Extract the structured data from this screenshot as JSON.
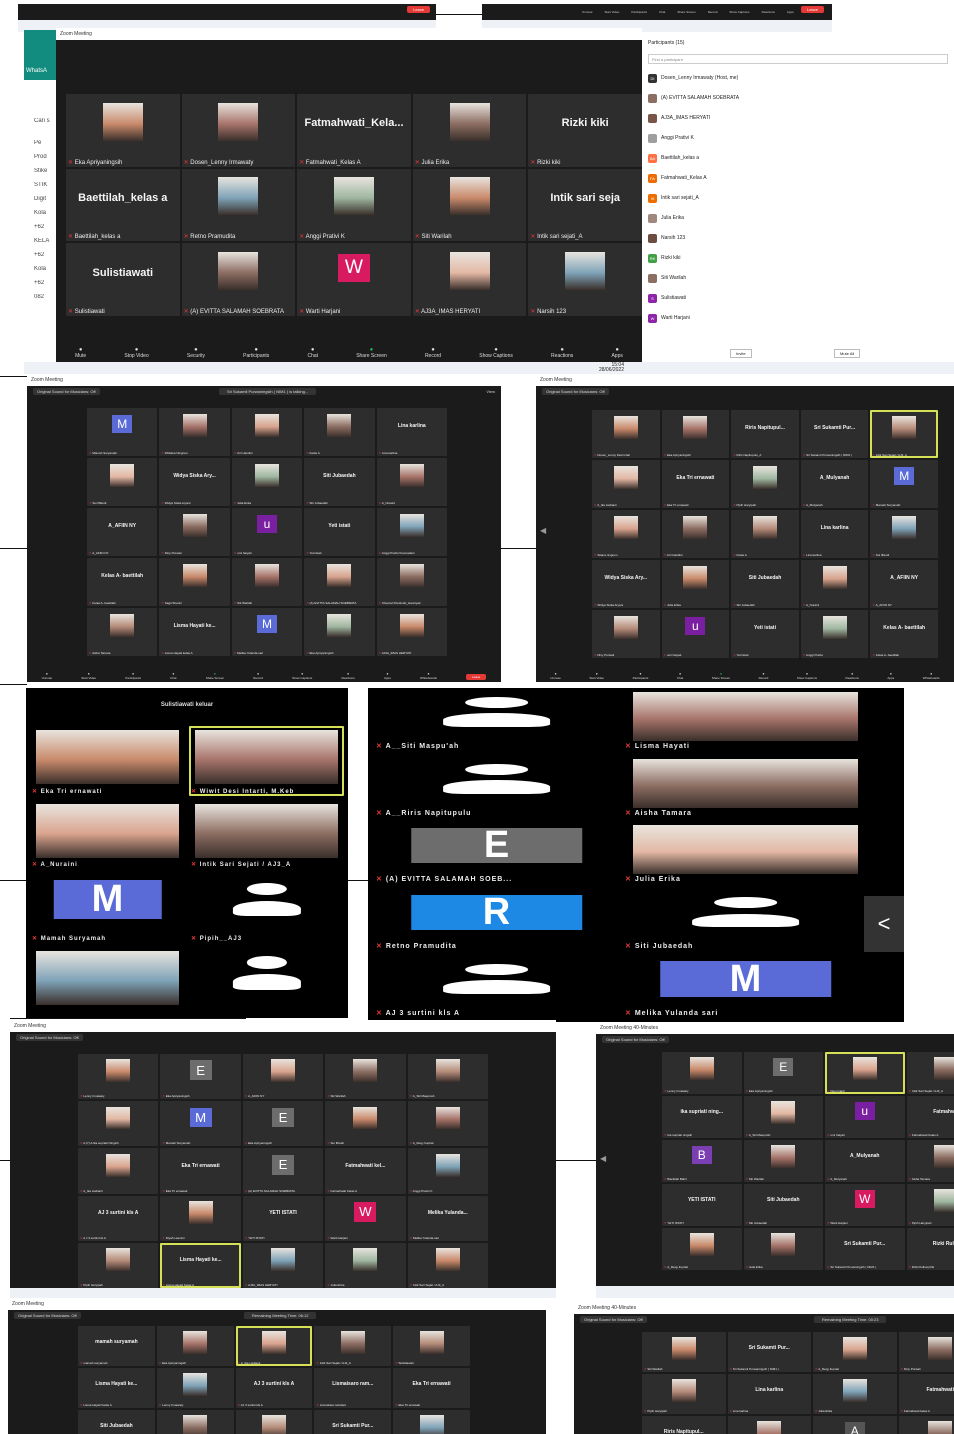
{
  "colors": {
    "accent": "#2d8cff",
    "end": "#e53935",
    "highlight": "#d4e157",
    "muted_mic": "#e53935"
  },
  "top_window": {
    "title": "Zoom Meeting",
    "whatsapp_label": "WhatsA",
    "left_items": [
      "Cari s",
      "Pe",
      "Prod",
      "Stike",
      "STIK",
      "Digit",
      "Kola",
      "+62",
      "KELA",
      "+62",
      "Kola",
      "+62",
      "082"
    ],
    "tiles": [
      {
        "name": "Eka Apriyaningsih",
        "big": "",
        "kind": "photo"
      },
      {
        "name": "Dosen_Lenny Irmawaty",
        "big": "",
        "kind": "photo"
      },
      {
        "name": "Fatmahwati_Kelas A",
        "big": "Fatmahwati_Kela...",
        "kind": "text"
      },
      {
        "name": "Julia Erika",
        "big": "",
        "kind": "photo"
      },
      {
        "name": "Rizki kiki",
        "big": "Rizki kiki",
        "kind": "text"
      },
      {
        "name": "Baettilah_kelas a",
        "big": "Baettilah_kelas a",
        "kind": "text"
      },
      {
        "name": "Retno Pramudita",
        "big": "",
        "kind": "photo"
      },
      {
        "name": "Anggi Prativi K",
        "big": "",
        "kind": "photo"
      },
      {
        "name": "Siti Warilah",
        "big": "",
        "kind": "photo"
      },
      {
        "name": "Intik sari sejati_A",
        "big": "Intik sari seja",
        "kind": "text"
      },
      {
        "name": "Sulistiawati",
        "big": "Sulistiawati",
        "kind": "text"
      },
      {
        "name": "(A) EVITTA SALAMAH SOEBRATA",
        "big": "",
        "kind": "photo"
      },
      {
        "name": "Warti Harjani",
        "big": "W",
        "kind": "avatar"
      },
      {
        "name": "AJ3A_IMAS HERYATI",
        "big": "",
        "kind": "photo"
      },
      {
        "name": "Narsih 123",
        "big": "",
        "kind": "photo"
      }
    ],
    "controls": [
      "Mute",
      "Stop Video",
      "Security",
      "Participants",
      "Chat",
      "Share Screen",
      "Record",
      "Show Captions",
      "Reactions",
      "Apps"
    ],
    "participants_count": "15",
    "clock": {
      "time": "15:04",
      "date": "28/06/2022"
    },
    "participants_panel": {
      "title": "Participants (15)",
      "search_placeholder": "Find a participant",
      "items": [
        "Dosen_Lenny Irmawaty (Host, me)",
        "(A) EVITTA SALAMAH SOEBRATA",
        "AJ3A_IMAS HERYATI",
        "Anggi Prativi K",
        "Baettilah_kelas a",
        "Fatmahwati_Kelas A",
        "Intik sari sejati_A",
        "Julia Erika",
        "Narsih 123",
        "Rizki kiki",
        "Siti Warilah",
        "Sulistiawati",
        "Warti Harjani"
      ],
      "initials": [
        "DI",
        "",
        "",
        "",
        "BA",
        "FA",
        "IS",
        "",
        "",
        "RK",
        "",
        "S",
        "W"
      ],
      "invite": "Invite",
      "mute_all": "Mute All"
    }
  },
  "win2": {
    "sound": "Original Sound for Musicians: Off",
    "talking": "Sri Sukamti Purwaningsih ( NIM1 ) is talking...",
    "view": "View",
    "tiles": [
      {
        "name": "Mamah Suryamah",
        "big": "M",
        "kind": "avatar"
      },
      {
        "name": "Widiana Ningrum",
        "big": "",
        "kind": "photo"
      },
      {
        "name": "Arri Handini",
        "big": "",
        "kind": "photo"
      },
      {
        "name": "Kelas A",
        "big": "",
        "kind": "photo"
      },
      {
        "name": "Lina karlina",
        "big": "Lina karlina",
        "kind": "text"
      },
      {
        "name": "Sui Ilffandi",
        "big": "",
        "kind": "photo"
      },
      {
        "name": "Widya Siska Aryani",
        "big": "Widya Siska Ary...",
        "kind": "text"
      },
      {
        "name": "Julia Erika",
        "big": "",
        "kind": "photo"
      },
      {
        "name": "Siti Jubaedah",
        "big": "Siti Jubaedah",
        "kind": "text"
      },
      {
        "name": "A_Nuraini",
        "big": "",
        "kind": "photo"
      },
      {
        "name": "A_AFIIN NY",
        "big": "A_AFIIN NY",
        "kind": "text"
      },
      {
        "name": "Diny Purwati",
        "big": "",
        "kind": "photo"
      },
      {
        "name": "umi haiyati",
        "big": "u",
        "kind": "avatar"
      },
      {
        "name": "Yeti istati",
        "big": "Yeti istati",
        "kind": "text"
      },
      {
        "name": "Anggi Prativi Kusmadani",
        "big": "",
        "kind": "photo"
      },
      {
        "name": "Kelas A- baettilah",
        "big": "Kelas A- baettilah",
        "kind": "text"
      },
      {
        "name": "Sagit Sherini",
        "big": "",
        "kind": "photo"
      },
      {
        "name": "Siti Warilah",
        "big": "",
        "kind": "photo"
      },
      {
        "name": "(A) EVITTA SALAMAH SOEBRATA",
        "big": "",
        "kind": "photo"
      },
      {
        "name": "Khusnul Khotimah_Hanniyati",
        "big": "",
        "kind": "photo"
      },
      {
        "name": "Aisha Tamara",
        "big": "",
        "kind": "photo"
      },
      {
        "name": "Lisma Hayati kelas A",
        "big": "Lisma Hayati ke...",
        "kind": "text"
      },
      {
        "name": "Melika Yulanda sari",
        "big": "M",
        "kind": "avatar"
      },
      {
        "name": "Eka Apriyaningsih",
        "big": "",
        "kind": "photo"
      },
      {
        "name": "AJ3A_IMAS HERYATI",
        "big": "",
        "kind": "photo"
      }
    ],
    "controls": [
      "Unmute",
      "Start Video",
      "Participants",
      "Chat",
      "Share Screen",
      "Record",
      "Show Captions",
      "Reactions",
      "Apps",
      "Whiteboards"
    ],
    "count": "34",
    "end": "Leave"
  },
  "win3": {
    "title": "Zoom Meeting",
    "sound": "Original Sound for Musicians: Off",
    "tiles": [
      {
        "name": "Dosen_Lenny Desi Intari",
        "big": "",
        "kind": "photo"
      },
      {
        "name": "Eka Apriyaningsih",
        "big": "",
        "kind": "photo"
      },
      {
        "name": "Riris Napitupulu_A",
        "big": "Riris Napitupul...",
        "kind": "text"
      },
      {
        "name": "Sri Sukamti Purwaningsih ( NIM1 )",
        "big": "Sri Sukamti Pur...",
        "kind": "text"
      },
      {
        "name": "Intik Sari Sejati / AJ3_A",
        "big": "",
        "kind": "photo",
        "hl": true
      },
      {
        "name": "A_Ika Lisdianti",
        "big": "",
        "kind": "photo"
      },
      {
        "name": "Eka Tri ernawati",
        "big": "Eka Tri ernawati",
        "kind": "text"
      },
      {
        "name": "Pipih Haryipah",
        "big": "",
        "kind": "photo"
      },
      {
        "name": "A_Mulyanah",
        "big": "A_Mulyanah",
        "kind": "text"
      },
      {
        "name": "Mamah Suryamah",
        "big": "M",
        "kind": "avatar"
      },
      {
        "name": "Sitana ningrum",
        "big": "",
        "kind": "photo"
      },
      {
        "name": "Arri Haridini",
        "big": "",
        "kind": "photo"
      },
      {
        "name": "Kelas A",
        "big": "",
        "kind": "photo"
      },
      {
        "name": "Lina karlina",
        "big": "Lina karlina",
        "kind": "text"
      },
      {
        "name": "Sui Iffandi",
        "big": "",
        "kind": "photo"
      },
      {
        "name": "Widya Siska Aryani",
        "big": "Widya Siska Ary...",
        "kind": "text"
      },
      {
        "name": "Julia Erika",
        "big": "",
        "kind": "photo"
      },
      {
        "name": "Siti Jubaedah",
        "big": "Siti Jubaedah",
        "kind": "text"
      },
      {
        "name": "A_Nuraini",
        "big": "",
        "kind": "photo"
      },
      {
        "name": "A_AFIIN NY",
        "big": "A_AFIIN NY",
        "kind": "text"
      },
      {
        "name": "Diny Purwati",
        "big": "",
        "kind": "photo"
      },
      {
        "name": "umi haiyati",
        "big": "u",
        "kind": "avatar"
      },
      {
        "name": "Yeti istati",
        "big": "Yeti istati",
        "kind": "text"
      },
      {
        "name": "Anggi Prativi",
        "big": "",
        "kind": "photo"
      },
      {
        "name": "Kelas A- baettilah",
        "big": "Kelas A- baettilah",
        "kind": "text"
      }
    ],
    "controls": [
      "Unmute",
      "Start Video",
      "Participants",
      "Chat",
      "Share Screen",
      "Record",
      "Show Captions",
      "Reactions",
      "Apps",
      "Whiteboards"
    ]
  },
  "phone1": {
    "banner": "Sulistiawati keluar",
    "tiles": [
      {
        "name": "Eka Tri ernawati",
        "kind": "photo"
      },
      {
        "name": "Wiwit Desi Intarti, M.Keb",
        "kind": "photo",
        "hl": true
      },
      {
        "name": "A_Nuraini",
        "kind": "photo"
      },
      {
        "name": "Intik Sari Sejati / AJ3_A",
        "kind": "photo"
      },
      {
        "name": "Mamah Suryamah",
        "kind": "avatar",
        "big": "M"
      },
      {
        "name": "Pipih__AJ3",
        "kind": "silhouette"
      },
      {
        "name": "",
        "kind": "photo"
      },
      {
        "name": "",
        "kind": "silhouette"
      }
    ]
  },
  "phone2": {
    "tiles": [
      {
        "name": "A__Siti Maspu'ah",
        "kind": "silhouette"
      },
      {
        "name": "Lisma Hayati",
        "kind": "photo"
      },
      {
        "name": "A__Riris Napitupulu",
        "kind": "silhouette"
      },
      {
        "name": "Aisha Tamara",
        "kind": "photo"
      },
      {
        "name": "(A) EVITTA SALAMAH SOEB...",
        "kind": "avatar",
        "big": "E"
      },
      {
        "name": "Julia Erika",
        "kind": "photo"
      },
      {
        "name": "Retno Pramudita",
        "kind": "avatar",
        "big": "R"
      },
      {
        "name": "Siti Jubaedah",
        "kind": "silhouette"
      },
      {
        "name": "AJ 3 surtini kls A",
        "kind": "silhouette"
      },
      {
        "name": "Melika Yulanda sari",
        "kind": "avatar",
        "big": "M"
      }
    ],
    "nav": "<"
  },
  "win4": {
    "title": "Zoom Meeting",
    "sound": "Original Sound for Musicians: Off",
    "tiles": [
      {
        "name": "Lenny Irmawaty",
        "big": "",
        "kind": "photo"
      },
      {
        "name": "Eka Apriyaningsih",
        "big": "E",
        "kind": "avatar"
      },
      {
        "name": "A_AFIIN NY",
        "big": "",
        "kind": "photo"
      },
      {
        "name": "Siti Warilah",
        "big": "",
        "kind": "photo"
      },
      {
        "name": "A_Siti Maspu'ah",
        "big": "",
        "kind": "photo"
      },
      {
        "name": "A.(7) A.Ika supriati Ningsih",
        "big": "",
        "kind": "photo"
      },
      {
        "name": "Mamah Suryamah",
        "big": "M",
        "kind": "avatar"
      },
      {
        "name": "Eka Apriyaningsih",
        "big": "E",
        "kind": "avatar"
      },
      {
        "name": "Sui Iffandi",
        "big": "",
        "kind": "photo"
      },
      {
        "name": "A_Reqy Itupriat",
        "big": "",
        "kind": "photo"
      },
      {
        "name": "A_Ika Lisdianti",
        "big": "",
        "kind": "photo"
      },
      {
        "name": "Eka Tri ernawati",
        "big": "Eka Tri ernawati",
        "kind": "text"
      },
      {
        "name": "(A) EVITTA SALAMAH SOEBRATA",
        "big": "E",
        "kind": "avatar"
      },
      {
        "name": "Fatmahwati Kelas A",
        "big": "Fatmahwati kel...",
        "kind": "text"
      },
      {
        "name": "Anggi Prativi K",
        "big": "",
        "kind": "photo"
      },
      {
        "name": "A J 3 surtini kls A",
        "big": "AJ 3 surtini kls A",
        "kind": "text"
      },
      {
        "name": "Diyah Lasmini",
        "big": "",
        "kind": "photo"
      },
      {
        "name": "YETI ISTATI",
        "big": "YETI ISTATI",
        "kind": "text"
      },
      {
        "name": "Warti Harjani",
        "big": "W",
        "kind": "avatar"
      },
      {
        "name": "Melika Yulanda sari",
        "big": "Melika Yulanda...",
        "kind": "text"
      },
      {
        "name": "Pipih Haryipah",
        "big": "",
        "kind": "photo"
      },
      {
        "name": "Lisma Hayati Kelas A",
        "big": "Lisma Hayati ke...",
        "kind": "text",
        "hl": true
      },
      {
        "name": "AJ3A_IMAS HERYATI",
        "big": "",
        "kind": "photo"
      },
      {
        "name": "Julia Erika",
        "big": "",
        "kind": "photo"
      },
      {
        "name": "Intik Sari Sejati / AJ3_A",
        "big": "",
        "kind": "photo"
      }
    ]
  },
  "win5": {
    "title": "Zoom Meeting 40-Minutes",
    "sound": "Original Sound for Musicians: Off",
    "tiles": [
      {
        "name": "Lenny Irmawaty",
        "big": "",
        "kind": "photo"
      },
      {
        "name": "Eka Apriyaningsih",
        "big": "E",
        "kind": "avatar"
      },
      {
        "name": "Desi Intarti",
        "big": "",
        "kind": "photo",
        "hl": true
      },
      {
        "name": "Intik Sari Sejati / AJ3_A",
        "big": "",
        "kind": "photo"
      },
      {
        "name": "Ika supriati ningsih",
        "big": "ika supriati ning...",
        "kind": "text"
      },
      {
        "name": "A_Siti Maspu'ah",
        "big": "",
        "kind": "photo"
      },
      {
        "name": "umi haiyati",
        "big": "u",
        "kind": "avatar"
      },
      {
        "name": "Fatmahwati Kelas A",
        "big": "Fatmahwat",
        "kind": "text"
      },
      {
        "name": "Baettilah Bahri",
        "big": "B",
        "kind": "avatar"
      },
      {
        "name": "Siti Warilah",
        "big": "",
        "kind": "photo"
      },
      {
        "name": "A_Mulyanah",
        "big": "A_Mulyanah",
        "kind": "text"
      },
      {
        "name": "Aisha Tamara",
        "big": "",
        "kind": "photo"
      },
      {
        "name": "YETI ISTATI",
        "big": "YETI ISTATI",
        "kind": "text"
      },
      {
        "name": "Siti Jubaedah",
        "big": "Siti Jubaedah",
        "kind": "text"
      },
      {
        "name": "Warti Harjani",
        "big": "W",
        "kind": "avatar"
      },
      {
        "name": "Pipih Haryipah",
        "big": "",
        "kind": "photo"
      },
      {
        "name": "A_Reqy Itupriat",
        "big": "",
        "kind": "photo"
      },
      {
        "name": "Julia Erika",
        "big": "",
        "kind": "photo"
      },
      {
        "name": "Sri Sukamti Purwaningsih ( NIM1 )",
        "big": "Sri Sukamti Pur...",
        "kind": "text"
      },
      {
        "name": "Rizki Kulhaq Kiki",
        "big": "Rizki Rulha",
        "kind": "text"
      }
    ],
    "count": "34"
  },
  "win6": {
    "title": "Zoom Meeting",
    "sound": "Original Sound for Musicians: Off",
    "remaining": "Remaining Meeting Time: 06:12",
    "tiles": [
      {
        "name": "mamah suryamah",
        "big": "mamah suryamah",
        "kind": "text"
      },
      {
        "name": "Eka Apriyaningsih",
        "big": "",
        "kind": "photo"
      },
      {
        "name": "A_Ika Lisdianti",
        "big": "",
        "kind": "photo",
        "hl": true
      },
      {
        "name": "Intik Sari Sejati / AJ3_A",
        "big": "",
        "kind": "photo"
      },
      {
        "name": "Sulistiawati",
        "big": "",
        "kind": "photo"
      },
      {
        "name": "Lisma Hayati Kelas A",
        "big": "Lisma Hayati ke...",
        "kind": "text"
      },
      {
        "name": "Lenny Irmawaty",
        "big": "",
        "kind": "photo"
      },
      {
        "name": "AJ 3 surtini kls A",
        "big": "AJ 3 surtini kls A",
        "kind": "text"
      },
      {
        "name": "Lismaisaro ramdani",
        "big": "Lismaisaro ram...",
        "kind": "text"
      },
      {
        "name": "Eka Tri ernawati",
        "big": "Eka Tri ernawati",
        "kind": "text"
      },
      {
        "name": "",
        "big": "Siti Jubaedah",
        "kind": "text"
      },
      {
        "name": "",
        "big": "",
        "kind": "photo"
      },
      {
        "name": "",
        "big": "",
        "kind": "photo"
      },
      {
        "name": "",
        "big": "Sri Sukamti Pur...",
        "kind": "text"
      },
      {
        "name": "",
        "big": "",
        "kind": "photo"
      }
    ]
  },
  "win7": {
    "title": "Zoom Meeting 40-Minutes",
    "sound": "Original Sound for Musicians: Off",
    "remaining": "Remaining Meeting Time: 00:23",
    "tiles": [
      {
        "name": "Siti Warilah",
        "big": "",
        "kind": "photo"
      },
      {
        "name": "Sri Sukamti Purwaningsih ( NIM1 )",
        "big": "Sri Sukamti Pur...",
        "kind": "text"
      },
      {
        "name": "A_Reqy Itupriat",
        "big": "",
        "kind": "photo"
      },
      {
        "name": "Diny Purwati",
        "big": "",
        "kind": "photo"
      },
      {
        "name": "Pipih Haryipah",
        "big": "",
        "kind": "photo"
      },
      {
        "name": "Lina karlina",
        "big": "Lina karlina",
        "kind": "text"
      },
      {
        "name": "Julia Erika",
        "big": "",
        "kind": "photo"
      },
      {
        "name": "Fatmahwati kelas A",
        "big": "Fatmahwati",
        "kind": "text"
      },
      {
        "name": "",
        "big": "Riris Napitupul...",
        "kind": "text"
      },
      {
        "name": "",
        "big": "",
        "kind": "photo"
      },
      {
        "name": "",
        "big": "A",
        "kind": "avatar"
      },
      {
        "name": "",
        "big": "",
        "kind": "photo"
      }
    ]
  },
  "top_right_strip": {
    "items": [
      "Unmute",
      "Start Video",
      "Participants",
      "Chat",
      "Share Screen",
      "Record",
      "Show Captions",
      "Reactions",
      "Apps"
    ],
    "end": "Leave"
  }
}
